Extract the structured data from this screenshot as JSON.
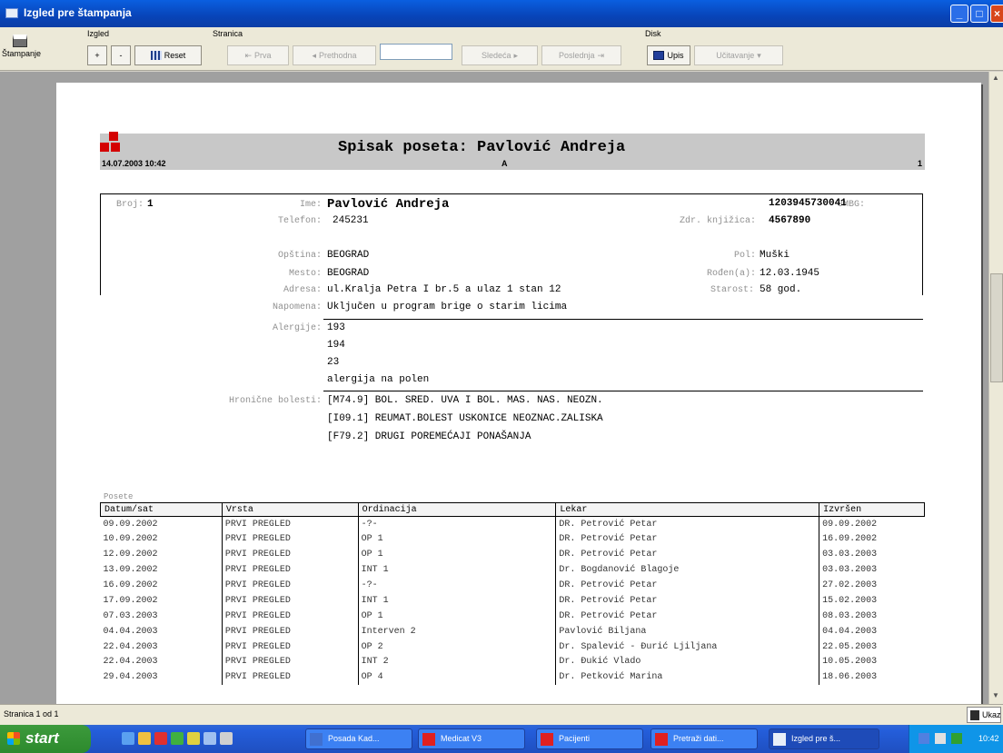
{
  "window": {
    "title": "Izgled pre štampanja"
  },
  "toolbar": {
    "print_label": "Štampanje",
    "izgled_label": "Izgled",
    "stranica_label": "Stranica",
    "disk_label": "Disk",
    "zoom_in": "+",
    "zoom_out": "-",
    "reset_label": "Reset",
    "first_label": "Prva",
    "prev_label": "Prethodna",
    "next_label": "Sledeća",
    "last_label": "Poslednja",
    "save_label": "Upis",
    "open_label": "Učitavanje"
  },
  "report": {
    "title": "Spisak poseta: Pavlović Andreja",
    "datetime": "14.07.2003 10:42",
    "letter": "A",
    "page_no": "1",
    "patient": {
      "broj_label": "Broj:",
      "broj": "1",
      "ime_label": "Ime:",
      "ime": "Pavlović Andreja",
      "jmbg_label": "JMBG:",
      "jmbg": "1203945730041",
      "telefon_label": "Telefon:",
      "telefon": "245231",
      "zk_label": "Zdr. knjižica:",
      "zk": "4567890",
      "opstina_label": "Opština:",
      "opstina": "BEOGRAD",
      "pol_label": "Pol:",
      "pol": "Muški",
      "mesto_label": "Mesto:",
      "mesto": "BEOGRAD",
      "rodjen_label": "Rođen(a):",
      "rodjen": "12.03.1945",
      "adresa_label": "Adresa:",
      "adresa": "ul.Kralja Petra I br.5 a ulaz 1 stan 12",
      "starost_label": "Starost:",
      "starost": "58 god.",
      "napomena_label": "Napomena:",
      "napomena": "Uključen u program brige o starim licima",
      "alergije_label": "Alergije:",
      "alergije": [
        "193",
        "194",
        "23",
        "alergija na polen"
      ],
      "hronicne_label": "Hronične bolesti:",
      "hronicne": [
        "[M74.9] BOL. SRED. UVA I BOL. MAS. NAS. NEOZN.",
        "[I09.1] REUMAT.BOLEST USKONICE NEOZNAC.ZALISKA",
        "[F79.2] DRUGI POREMEĆAJI PONAŠANJA"
      ]
    },
    "visits_label": "Posete",
    "columns": [
      "Datum/sat",
      "Vrsta",
      "Ordinacija",
      "Lekar",
      "Izvršen"
    ],
    "visits": [
      [
        "09.09.2002",
        "PRVI PREGLED",
        "-?-",
        "DR. Petrović Petar",
        "09.09.2002"
      ],
      [
        "10.09.2002",
        "PRVI PREGLED",
        "OP 1",
        "DR. Petrović Petar",
        "16.09.2002"
      ],
      [
        "12.09.2002",
        "PRVI PREGLED",
        "OP 1",
        "DR. Petrović Petar",
        "03.03.2003"
      ],
      [
        "13.09.2002",
        "PRVI PREGLED",
        "INT 1",
        "Dr. Bogdanović Blagoje",
        "03.03.2003"
      ],
      [
        "16.09.2002",
        "PRVI PREGLED",
        "-?-",
        "DR. Petrović Petar",
        "27.02.2003"
      ],
      [
        "17.09.2002",
        "PRVI PREGLED",
        "INT 1",
        "DR. Petrović Petar",
        "15.02.2003"
      ],
      [
        "07.03.2003",
        "PRVI PREGLED",
        "OP 1",
        "DR. Petrović Petar",
        "08.03.2003"
      ],
      [
        "04.04.2003",
        "PRVI PREGLED",
        "Interven 2",
        "Pavlović Biljana",
        "04.04.2003"
      ],
      [
        "22.04.2003",
        "PRVI PREGLED",
        "OP 2",
        "Dr. Spalević - Đurić Ljiljana",
        "22.05.2003"
      ],
      [
        "22.04.2003",
        "PRVI PREGLED",
        "INT 2",
        "Dr. Đukić Vlado",
        "10.05.2003"
      ],
      [
        "29.04.2003",
        "PRVI PREGLED",
        "OP 4",
        "Dr. Petković Marina",
        "18.06.2003"
      ]
    ]
  },
  "status": {
    "page_text": "Stranica 1 od 1",
    "zoom_label": "Ukaz"
  },
  "taskbar": {
    "start": "start",
    "tasks": [
      "Posada Kad...",
      "Medicat V3",
      "Pacijenti",
      "Pretraži dati...",
      "Izgled pre š..."
    ],
    "clock": "10:42"
  }
}
